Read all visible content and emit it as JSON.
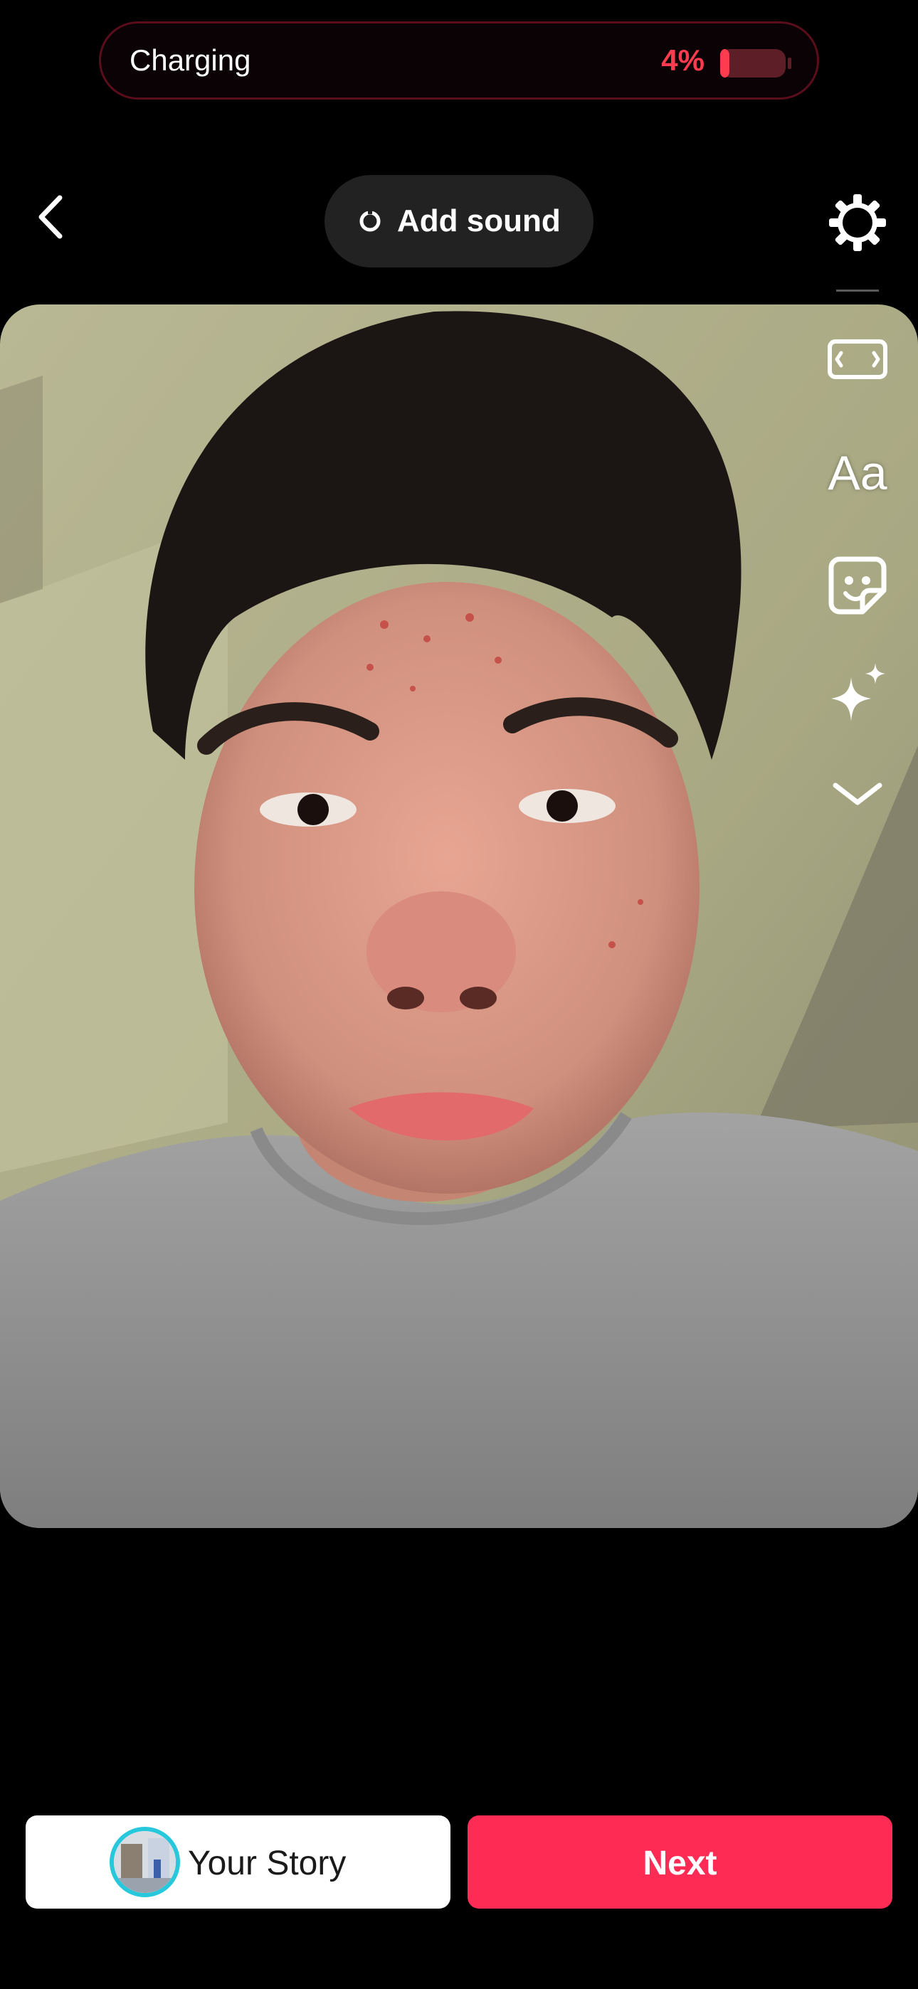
{
  "status_pill": {
    "label": "Charging",
    "battery_percent": "4%",
    "battery_level": 0.04,
    "accent_color": "#ff3b4f"
  },
  "topbar": {
    "back_icon": "chevron-left-icon",
    "add_sound_label": "Add sound",
    "add_sound_icon": "music-icon",
    "settings_icon": "gear-icon"
  },
  "side_tools": [
    {
      "name": "aspect-ratio-icon"
    },
    {
      "name": "text-tool",
      "label": "Aa"
    },
    {
      "name": "sticker-icon"
    },
    {
      "name": "effects-sparkle-icon"
    },
    {
      "name": "chevron-down-icon"
    }
  ],
  "bottom": {
    "story_label": "Your Story",
    "next_label": "Next",
    "next_color": "#fe2c55",
    "story_ring_color": "#28c8dc"
  }
}
